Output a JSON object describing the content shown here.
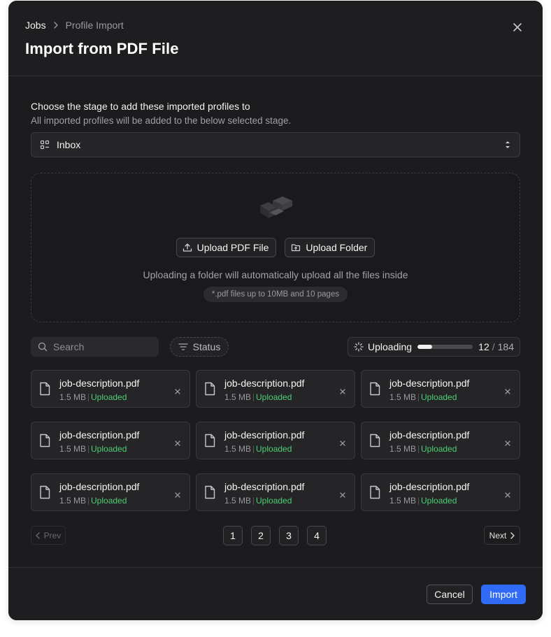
{
  "colors": {
    "accent": "#2f6bf5",
    "success": "#4ccf73",
    "surface": "#1c1c1e"
  },
  "header": {
    "breadcrumb": [
      "Jobs",
      "Profile Import"
    ],
    "title": "Import from PDF File",
    "close_icon": "close-icon"
  },
  "stage": {
    "title": "Choose the stage to add these imported profiles to",
    "subtitle": "All imported profiles will be added to the below selected stage.",
    "selected": "Inbox",
    "lead_icon": "stage-icon",
    "trail_icon": "chevron-up-down-icon"
  },
  "dropzone": {
    "upload_file_label": "Upload PDF File",
    "upload_folder_label": "Upload Folder",
    "info": "Uploading a folder will automatically upload all the files inside",
    "limit": "*.pdf files up to 10MB and 10 pages"
  },
  "toolbar": {
    "search_placeholder": "Search",
    "status_label": "Status",
    "uploading_label": "Uploading",
    "uploaded_count": "12",
    "separator": "/",
    "total_count": "184",
    "progress": 0.27
  },
  "files": [
    {
      "name": "job-description.pdf",
      "size": "1.5 MB",
      "status": "Uploaded"
    },
    {
      "name": "job-description.pdf",
      "size": "1.5 MB",
      "status": "Uploaded"
    },
    {
      "name": "job-description.pdf",
      "size": "1.5 MB",
      "status": "Uploaded"
    },
    {
      "name": "job-description.pdf",
      "size": "1.5 MB",
      "status": "Uploaded"
    },
    {
      "name": "job-description.pdf",
      "size": "1.5 MB",
      "status": "Uploaded"
    },
    {
      "name": "job-description.pdf",
      "size": "1.5 MB",
      "status": "Uploaded"
    },
    {
      "name": "job-description.pdf",
      "size": "1.5 MB",
      "status": "Uploaded"
    },
    {
      "name": "job-description.pdf",
      "size": "1.5 MB",
      "status": "Uploaded"
    },
    {
      "name": "job-description.pdf",
      "size": "1.5 MB",
      "status": "Uploaded"
    }
  ],
  "pagination": {
    "prev_label": "Prev",
    "next_label": "Next",
    "pages": [
      "1",
      "2",
      "3",
      "4"
    ]
  },
  "footer": {
    "cancel_label": "Cancel",
    "import_label": "Import"
  }
}
